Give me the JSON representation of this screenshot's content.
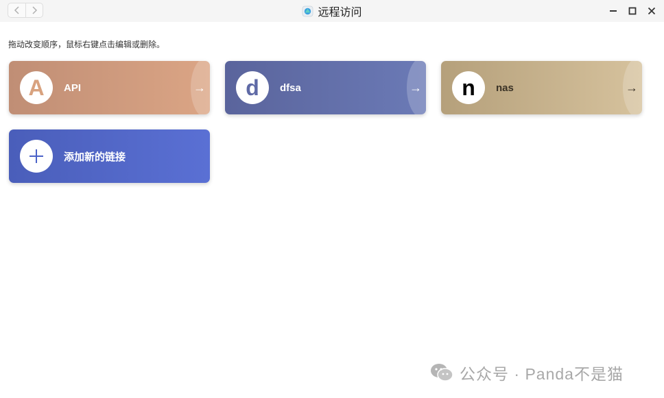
{
  "window": {
    "title": "远程访问"
  },
  "hint": "拖动改变顺序，鼠标右键点击编辑或删除。",
  "cards": [
    {
      "initial": "A",
      "label": "API",
      "arrow": "→",
      "accent": "#d8a27f"
    },
    {
      "initial": "d",
      "label": "dfsa",
      "arrow": "→",
      "accent": "#5f6aa6"
    },
    {
      "initial": "n",
      "label": "nas",
      "arrow": "→",
      "accent": "#000000"
    }
  ],
  "add_card": {
    "label": "添加新的链接",
    "icon": "plus-icon",
    "accent": "#4a62c8"
  },
  "watermark": {
    "text": "公众号 · Panda不是猫",
    "icon": "wechat-icon"
  }
}
